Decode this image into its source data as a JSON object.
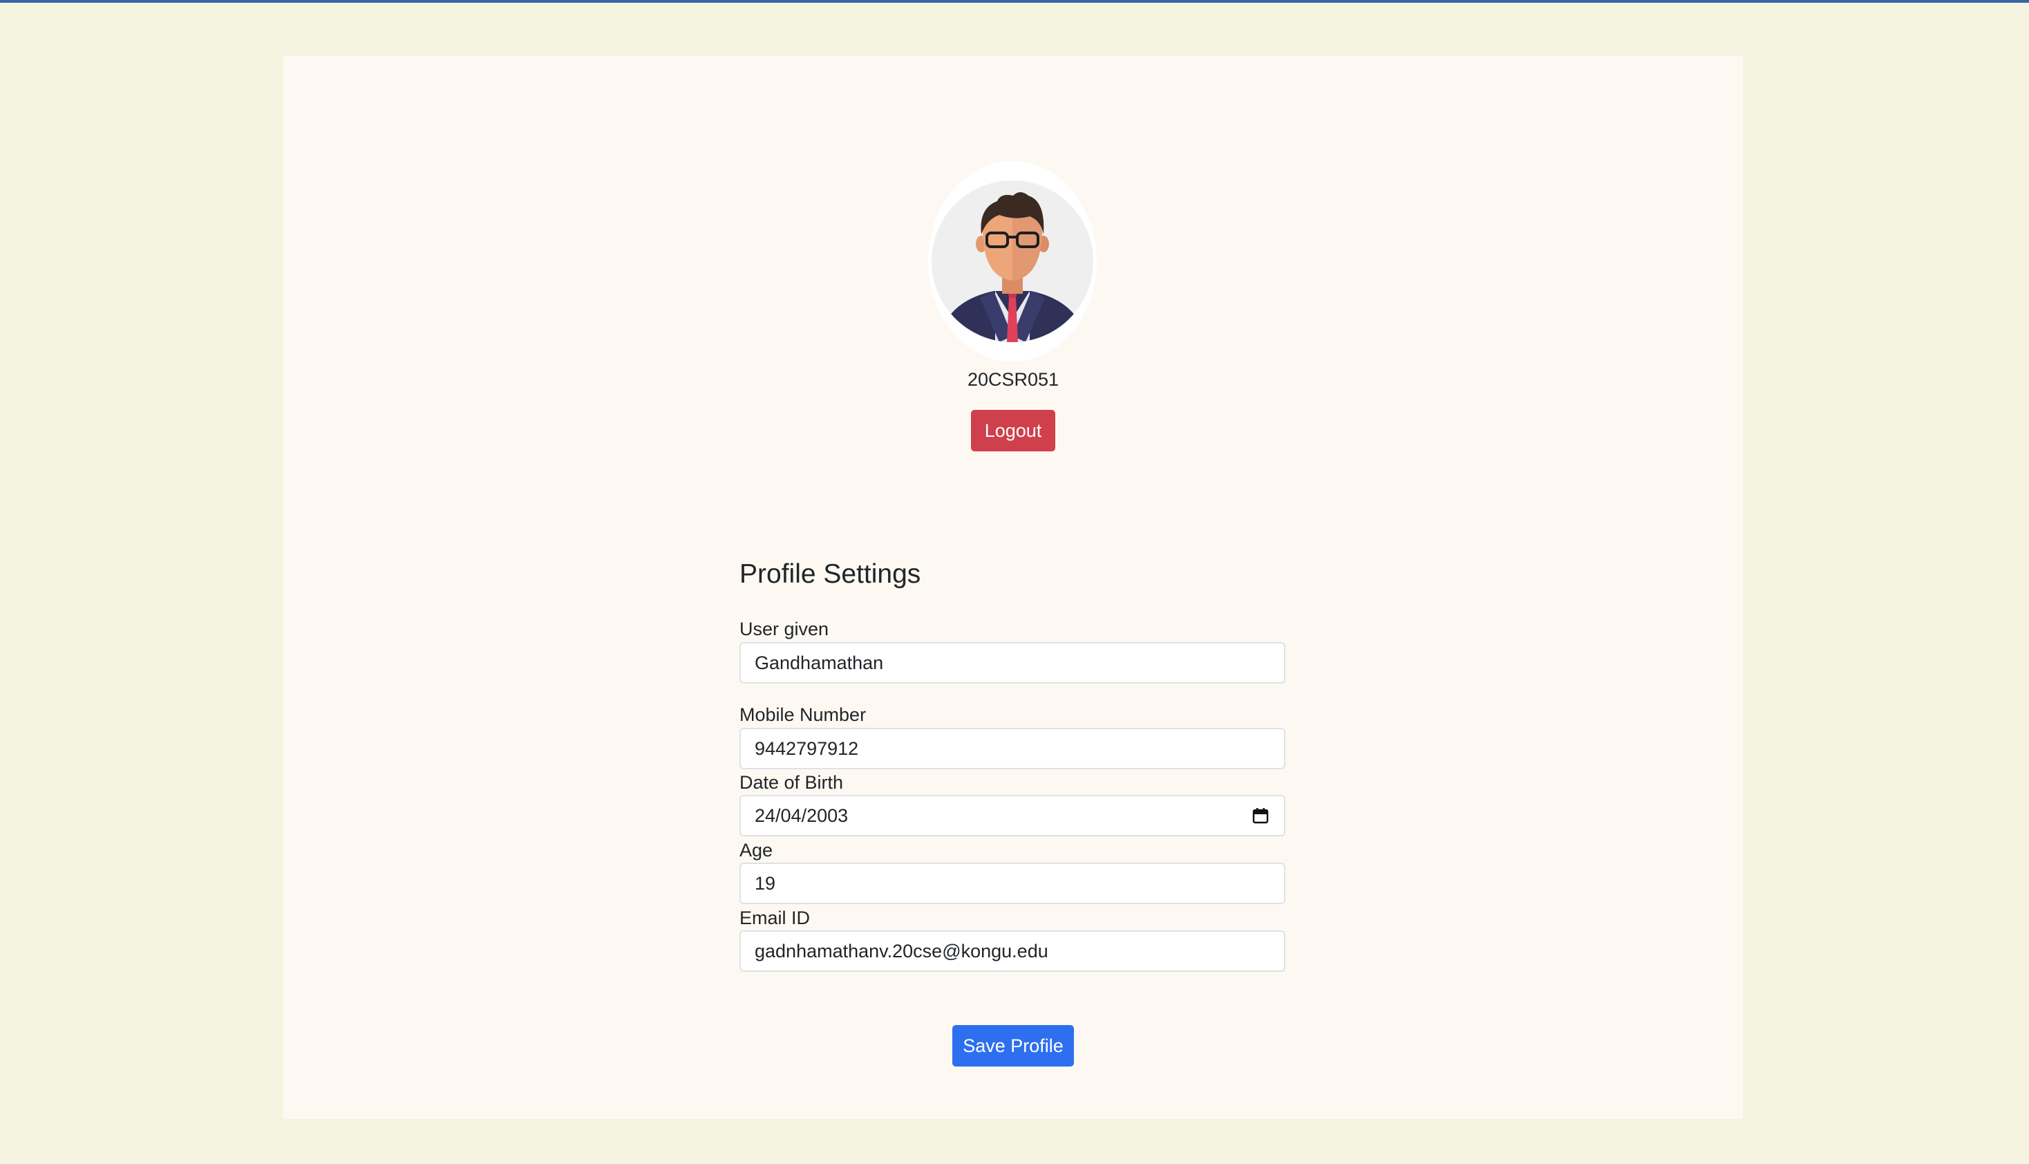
{
  "profile": {
    "user_id": "20CSR051",
    "logout_label": "Logout"
  },
  "settings": {
    "title": "Profile Settings",
    "fields": [
      {
        "label": "User given",
        "value": "Gandhamathan"
      },
      {
        "label": "Mobile Number",
        "value": "9442797912"
      },
      {
        "label": "Date of Birth",
        "value": "24/04/2003"
      },
      {
        "label": "Age",
        "value": "19"
      },
      {
        "label": "Email ID",
        "value": "gadnhamathanv.20cse@kongu.edu"
      }
    ],
    "save_label": "Save Profile"
  },
  "colors": {
    "background": "#f4f4e1",
    "card": "#fdf9f2",
    "logout": "#cf3f4c",
    "save": "#2e6ff0",
    "top_line": "#3a64a8"
  },
  "icons": {
    "avatar": "avatar-businessman",
    "date_picker": "calendar-icon"
  }
}
